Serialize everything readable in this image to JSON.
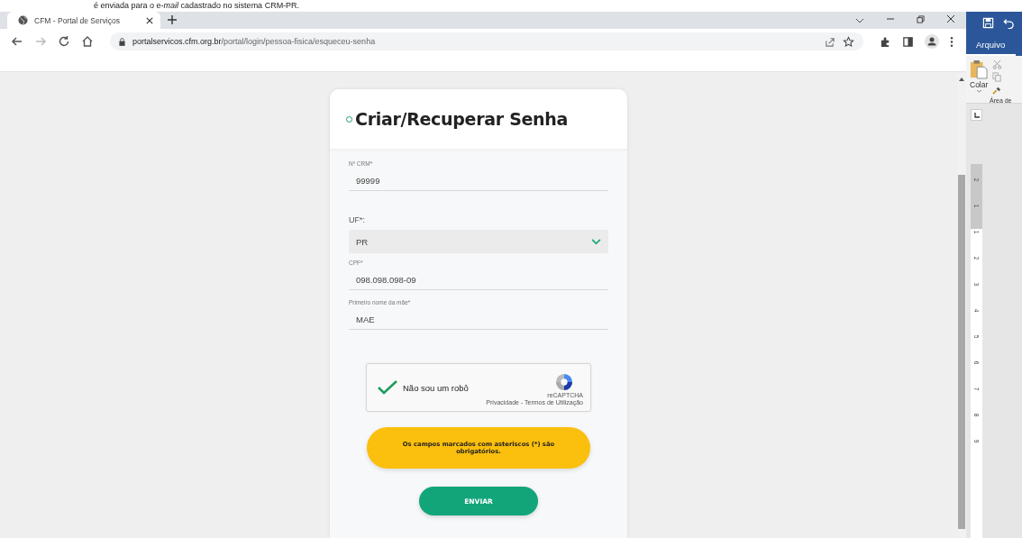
{
  "document_text": "é enviada para o e-*mail* cadastrado no sistema CRM-PR.",
  "browser": {
    "tabs": [
      {
        "title": "CFM - Portal de Serviços",
        "selected": true
      }
    ],
    "url_host": "portalservicos.cfm.org.br",
    "url_path": "/portal/login/pessoa-fisica/esqueceu-senha"
  },
  "form": {
    "title": "Criar/Recuperar Senha",
    "fields": [
      {
        "kind": "text",
        "label": "Nº CRM*",
        "value": "99999"
      },
      {
        "kind": "select",
        "label": "UF*:",
        "value": "PR"
      },
      {
        "kind": "text",
        "label": "CPF*",
        "value": "098.098.098-09"
      },
      {
        "kind": "text",
        "label": "Primeiro nome da mãe*",
        "value": "MAE"
      }
    ],
    "captcha": {
      "checked": true,
      "label": "Não sou um robô",
      "brand": "reCAPTCHA",
      "links": "Privacidade - Termos de Utilização"
    },
    "notice": "Os campos marcados com asteriscos (*) são obrigatórios.",
    "submit": "ENVIAR"
  },
  "word": {
    "tabs": [
      {
        "label": "Arquivo",
        "selected": true
      }
    ],
    "paste_label": "Colar",
    "group_label": "Área de",
    "ruler_numbers": [
      "2",
      "1",
      "1",
      "2",
      "3",
      "4",
      "5",
      "6",
      "7",
      "8",
      "9"
    ]
  }
}
